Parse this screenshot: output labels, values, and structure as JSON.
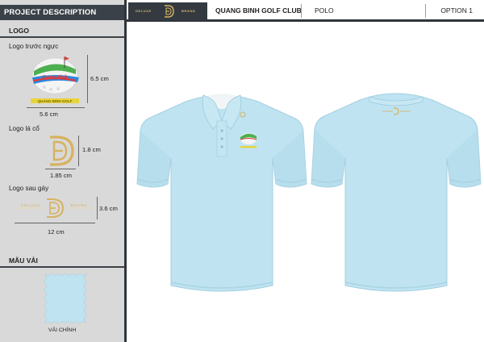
{
  "sidebar": {
    "header": "PROJECT DESCRIPTION",
    "logo_section_title": "LOGO",
    "front_logo": {
      "label": "Logo trước ngực",
      "height": "6.5 cm",
      "width": "5.6 cm",
      "logo_text": "Quang Bình"
    },
    "collar_logo": {
      "label": "Logo lá cổ",
      "height": "1.8 cm",
      "width": "1.85 cm"
    },
    "back_logo": {
      "label": "Logo sau gáy",
      "height": "3.6 cm",
      "width": "12 cm"
    },
    "fabric_section_title": "MẪU VẢI",
    "fabric_caption": "VẢI CHÍNH"
  },
  "header": {
    "brand_left": "DELUXE",
    "brand_right": "BRAND",
    "club_name": "QUANG BINH GOLF CLUB",
    "product": "POLO",
    "option": "OPTION 1"
  },
  "colors": {
    "shirt": "#bfe3f1",
    "shirt_shadow": "#a9d3e4",
    "gold": "#d7b25f",
    "dark": "#343a40",
    "sidebar_bg": "#d9d9d9"
  }
}
